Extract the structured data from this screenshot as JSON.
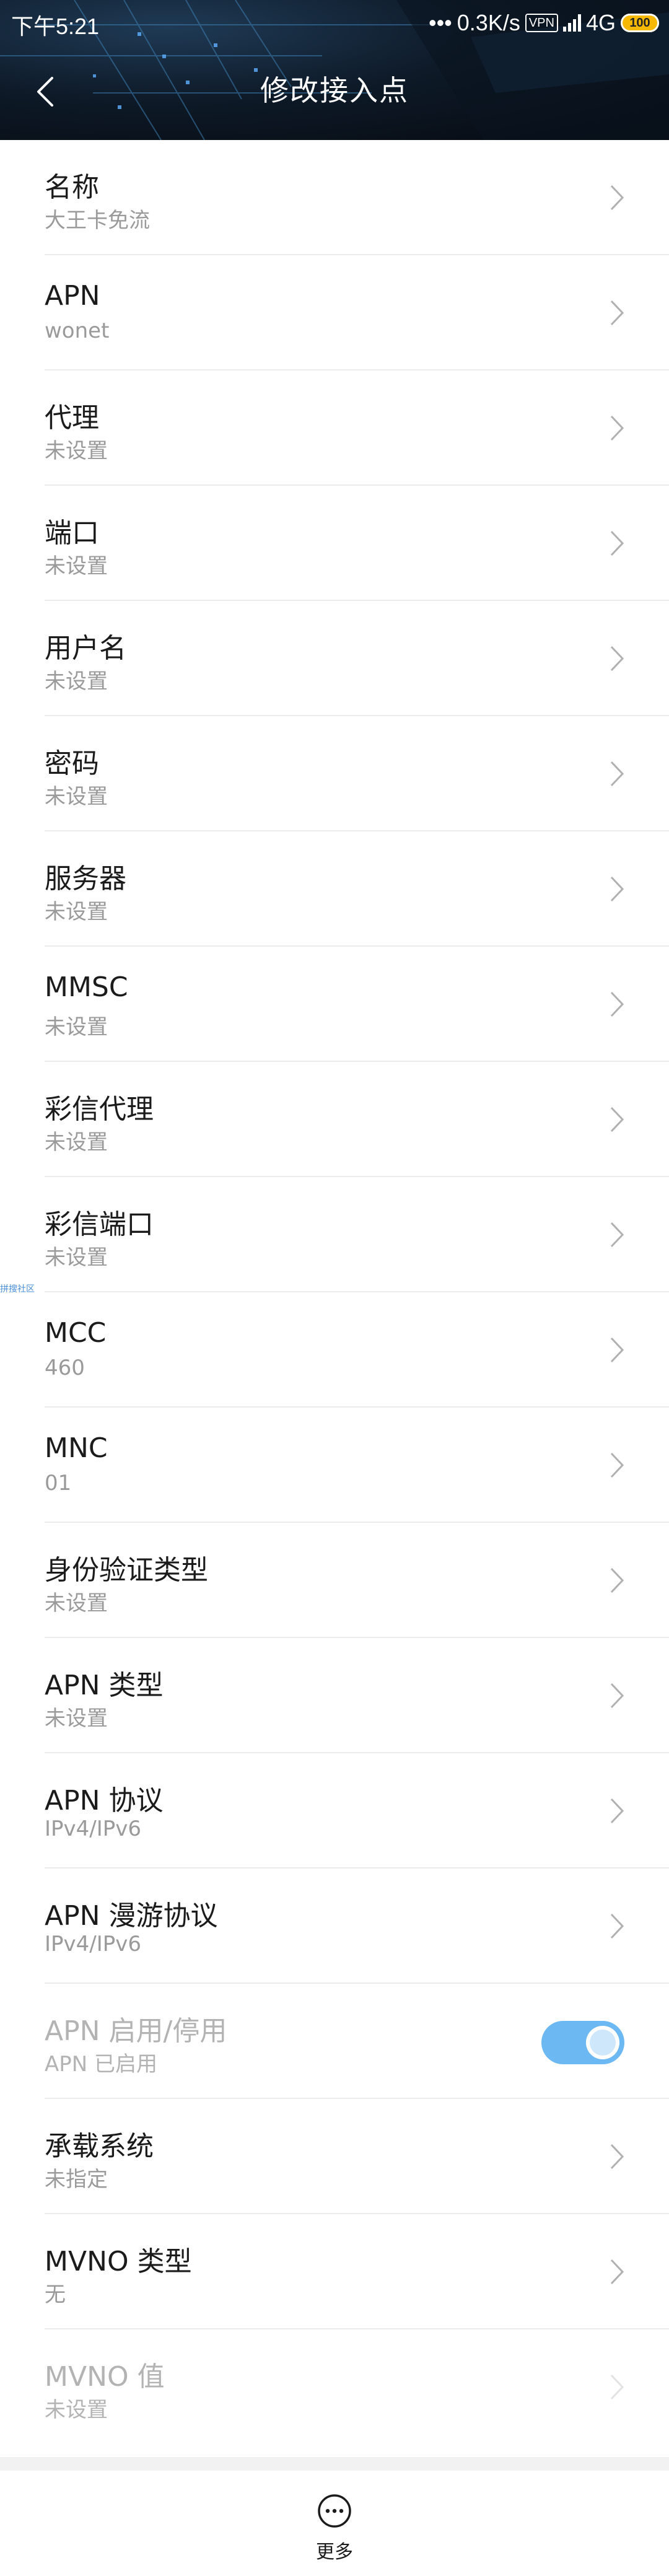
{
  "status_bar": {
    "time": "下午5:21",
    "net_speed": "0.3K/s",
    "vpn": "VPN",
    "network": "4G",
    "battery": "100"
  },
  "header": {
    "title": "修改接入点"
  },
  "items": [
    {
      "title": "名称",
      "value": "大王卡免流"
    },
    {
      "title": "APN",
      "value": "wonet"
    },
    {
      "title": "代理",
      "value": "未设置"
    },
    {
      "title": "端口",
      "value": "未设置"
    },
    {
      "title": "用户名",
      "value": "未设置"
    },
    {
      "title": "密码",
      "value": "未设置"
    },
    {
      "title": "服务器",
      "value": "未设置"
    },
    {
      "title": "MMSC",
      "value": "未设置"
    },
    {
      "title": "彩信代理",
      "value": "未设置"
    },
    {
      "title": "彩信端口",
      "value": "未设置"
    },
    {
      "title": "MCC",
      "value": "460"
    },
    {
      "title": "MNC",
      "value": "01"
    },
    {
      "title": "身份验证类型",
      "value": "未设置"
    },
    {
      "title": "APN 类型",
      "value": "未设置"
    },
    {
      "title": "APN 协议",
      "value": "IPv4/IPv6"
    },
    {
      "title": "APN 漫游协议",
      "value": "IPv4/IPv6"
    },
    {
      "title": "APN 启用/停用",
      "value": "APN 已启用",
      "toggle_on": true
    },
    {
      "title": "承载系统",
      "value": "未指定"
    },
    {
      "title": "MVNO 类型",
      "value": "无"
    },
    {
      "title": "MVNO 值",
      "value": "未设置"
    }
  ],
  "watermark": "拼搜社区",
  "bottom": {
    "more_label": "更多"
  },
  "colors": {
    "toggle_on": "#6bb8f2",
    "accent_battery": "#f6b800"
  }
}
